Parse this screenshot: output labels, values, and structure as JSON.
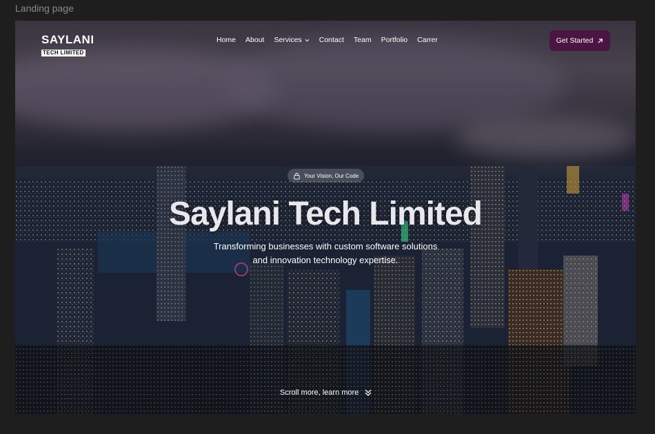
{
  "frame_label": "Landing page",
  "logo": {
    "top": "SAYLANI",
    "bottom": "TECH LIMITED"
  },
  "nav": {
    "items": [
      "Home",
      "About",
      "Services",
      "Contact",
      "Team",
      "Portfolio",
      "Carrer"
    ],
    "services_has_dropdown": true
  },
  "cta": {
    "label": "Get Started",
    "icon": "arrow-up-right-icon"
  },
  "badge": {
    "label": "Your Vision, Our Code",
    "icon": "lock-icon"
  },
  "hero": {
    "title": "Saylani Tech Limited",
    "subtitle_line1": "Transforming businesses with custom software solutions",
    "subtitle_line2": "and innovation technology expertise."
  },
  "scroll": {
    "label": "Scroll more, learn more",
    "icon": "double-chevron-down-icon"
  },
  "colors": {
    "page_bg": "#1e1e1e",
    "cta_bg": "#4a1540"
  }
}
